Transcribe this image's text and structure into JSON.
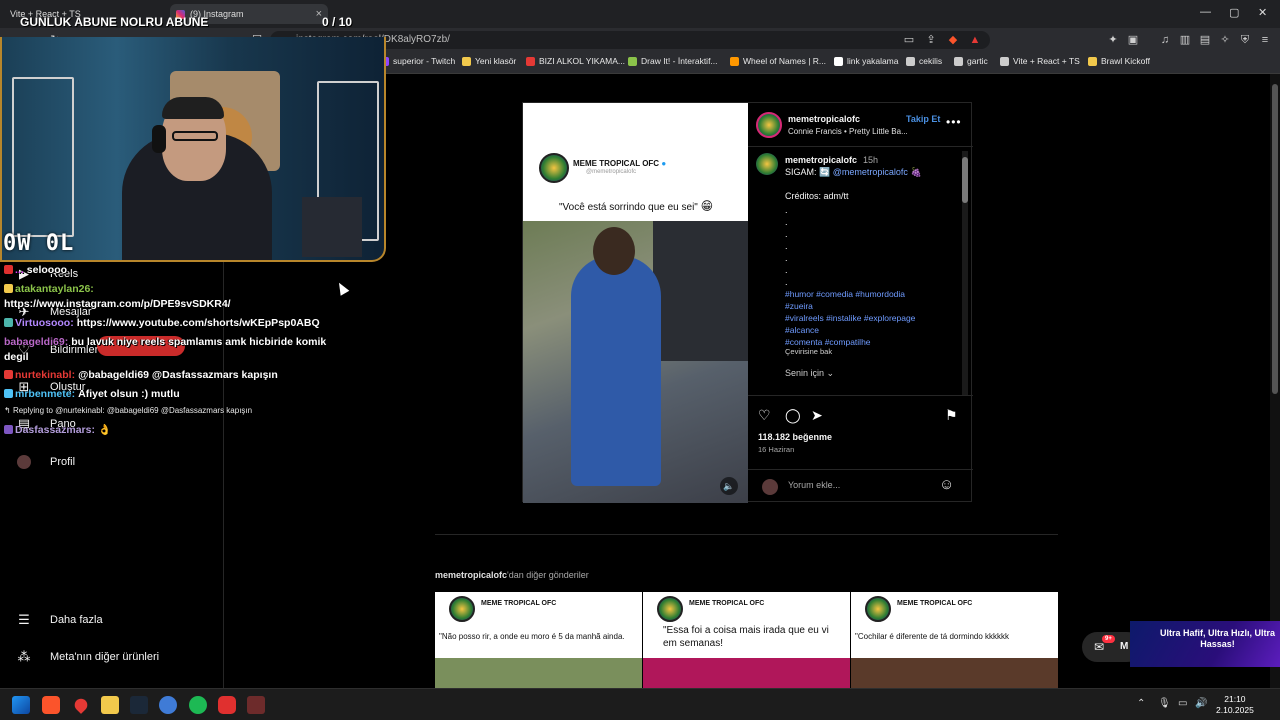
{
  "browser": {
    "tabs": [
      {
        "title": "Vite + React + TS"
      },
      {
        "title": "(9) Instagram"
      }
    ],
    "url_domain": "instagram.com",
    "url_path": "/reel/DK8alyRO7zb/",
    "bookmarks": [
      {
        "label": "superior - Twitch",
        "color": "#9146ff"
      },
      {
        "label": "Yeni klasör",
        "color": "#f2c94c"
      },
      {
        "label": "BIZI ALKOL YIKAMA...",
        "color": "#e53935"
      },
      {
        "label": "Draw It! - İnteraktif...",
        "color": "#8bc34a"
      },
      {
        "label": "Wheel of Names | R...",
        "color": "#ff9800"
      },
      {
        "label": "link yakalama",
        "color": "#ffffff"
      },
      {
        "label": "cekilis",
        "color": "#cccccc"
      },
      {
        "label": "gartic",
        "color": "#cccccc"
      },
      {
        "label": "Vite + React + TS",
        "color": "#cccccc"
      },
      {
        "label": "Brawl Kickoff",
        "color": "#f2c94c"
      }
    ]
  },
  "stream": {
    "sub_goal_title": "GUNLUK ABUNE NOLRU ABUNE",
    "sub_goal_count": "0 / 10",
    "webcam_logo": "0W 0L",
    "chat": [
      {
        "name": "...",
        "text": "seloooo",
        "color": "#e040fb",
        "badge": "#e0302f"
      },
      {
        "name": "atakantaylan26:",
        "text": "",
        "color": "#8bc34a",
        "badge": "#f2c94c"
      },
      {
        "name": "",
        "text": "https://www.instagram.com/p/DPE9svSDKR4/",
        "color": "#ffffff",
        "badge": ""
      },
      {
        "name": "Virtuosooo:",
        "text": "https://www.youtube.com/shorts/wKEpPsp0ABQ",
        "color": "#b388ff",
        "badge": "#4db6ac"
      },
      {
        "name": "babageldi69:",
        "text": "bu lavuk niye reels spamlamıs amk hicbiride komik",
        "color": "#ba68c8",
        "badge": ""
      },
      {
        "name": "",
        "text": "degil",
        "color": "#ffffff",
        "badge": ""
      },
      {
        "name": "nurtekinabl:",
        "text": "@babageldi69 @Dasfassazmars kapışın",
        "color": "#e53935",
        "badge": "#e53935"
      },
      {
        "name": "mrbenmete:",
        "text": "Afiyet olsun :) mutlu",
        "color": "#4fc3f7",
        "badge": "#4fc3f7"
      },
      {
        "name": "Dasfassazmars:",
        "text": "",
        "color": "#b39ddb",
        "badge": "#7e57c2"
      }
    ],
    "reply_line": "Replying to @nurtekinabl: @babageldi69 @Dasfassazmars kapışın",
    "promo": "Ultra Hafif, Ultra Hızlı, Ultra Hassas!"
  },
  "sidebar": {
    "items": [
      {
        "label": "Reels",
        "icon": "reels-icon",
        "glyph": "▶"
      },
      {
        "label": "Mesajlar",
        "icon": "messages-icon",
        "glyph": "✈"
      },
      {
        "label": "Bildirimler",
        "icon": "heart-icon",
        "glyph": "♡"
      },
      {
        "label": "Oluştur",
        "icon": "create-icon",
        "glyph": "⊞"
      },
      {
        "label": "Pano",
        "icon": "dashboard-icon",
        "glyph": "▤"
      },
      {
        "label": "Profil",
        "icon": "profile-icon",
        "glyph": ""
      }
    ],
    "more_label": "Daha fazla",
    "meta_label": "Meta'nın diğer ürünleri"
  },
  "post": {
    "media": {
      "brand_name": "MEME TROPICAL OFC",
      "brand_handle": "@memetropicalofc",
      "caption": "\"Você está sorrindo que eu sei\""
    },
    "author": "memetropicalofc",
    "follow_label": "Takip Et",
    "song": "Connie Francis • Pretty Little Ba...",
    "caption_user": "memetropicalofc",
    "caption_time": "15h",
    "sigam_label": "SIGAM:",
    "sigam_mention": "@memetropicalofc",
    "credits": "Créditos: adm/tt",
    "hashtag_lines": [
      "#humor #comedia #humordodia",
      "#zueira",
      "#viralreels #instalike #explorepage",
      "#alcance",
      "#comenta #compatilhe"
    ],
    "translate_label": "Çevirisine bak",
    "for_you_label": "Senin için",
    "likes": "118.182 beğenme",
    "date": "16 Haziran",
    "comment_placeholder": "Yorum ekle..."
  },
  "more_posts": {
    "title_user": "memetropicalofc",
    "title_rest": "'dan diğer gönderiler",
    "cards": [
      {
        "brand": "MEME TROPICAL OFC",
        "caption": "\"Não posso rir, a onde eu moro é 5 da manhã ainda.",
        "img_color": "#7a8f5c"
      },
      {
        "brand": "MEME TROPICAL OFC",
        "caption": "\"Essa foi a coisa mais irada que eu vi em semanas!",
        "img_color": "#b0175a"
      },
      {
        "brand": "MEME TROPICAL OFC",
        "caption": "\"Cochilar é diferente de tá dormindo kkkkkk",
        "img_color": "#5a3a2a"
      }
    ]
  },
  "messages_badge": "9+",
  "taskbar": {
    "time": "21:10",
    "date": "2.10.2025"
  }
}
